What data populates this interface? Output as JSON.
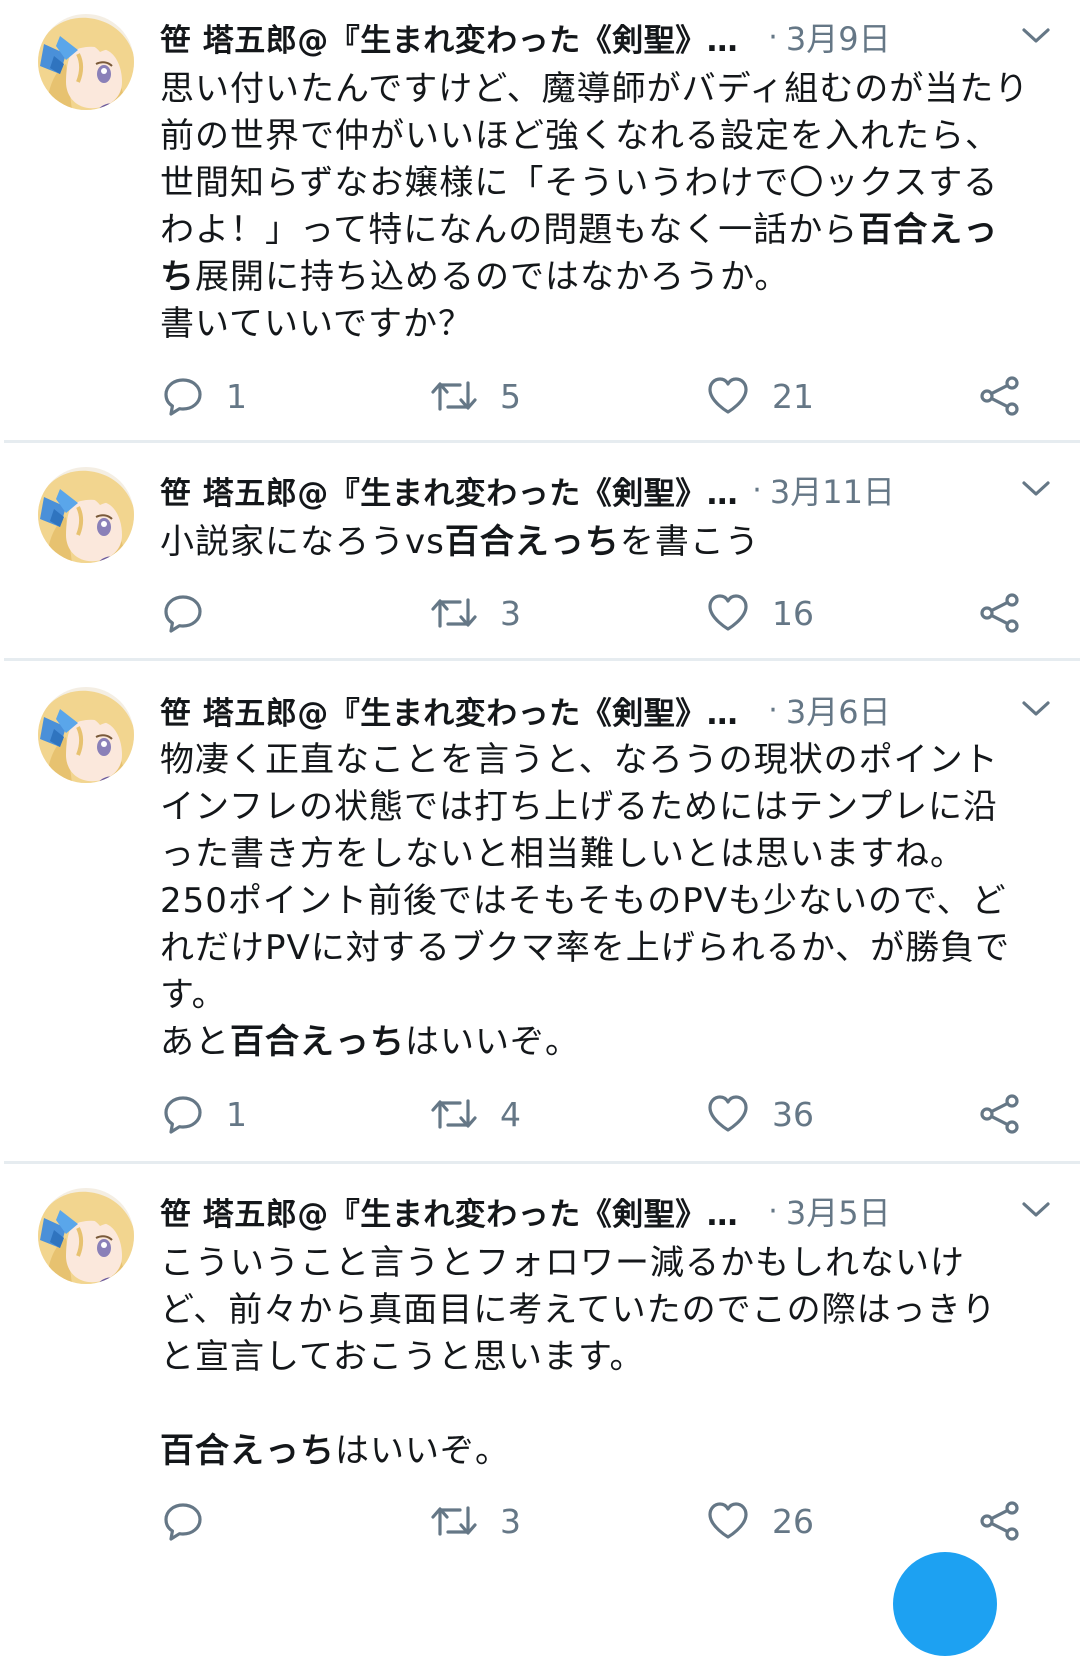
{
  "tweets": [
    {
      "author": "笹 塔五郎@『生まれ変わった《剣聖》…",
      "separator": "·",
      "date": "3月9日",
      "paragraphs": [
        [
          {
            "t": "思い付いたんですけど、魔導師がバディ組むのが当たり前の世界で仲がいいほど強くなれる設定を入れたら、世間知らずなお嬢様に「そういうわけで〇ックスするわよ！」って特になんの問題もなく一話から",
            "b": false
          },
          {
            "t": "百合えっち",
            "b": true
          },
          {
            "t": "展開に持ち込めるのではなかろうか。",
            "b": false
          }
        ],
        [
          {
            "t": "書いていいですか？",
            "b": false
          }
        ]
      ],
      "replies": "1",
      "retweets": "5",
      "likes": "21"
    },
    {
      "author": "笹 塔五郎@『生まれ変わった《剣聖》…",
      "separator": "·",
      "date": "3月11日",
      "paragraphs": [
        [
          {
            "t": "小説家になろうvs",
            "b": false
          },
          {
            "t": "百合えっち",
            "b": true
          },
          {
            "t": "を書こう",
            "b": false
          }
        ]
      ],
      "replies": "",
      "retweets": "3",
      "likes": "16"
    },
    {
      "author": "笹 塔五郎@『生まれ変わった《剣聖》…",
      "separator": "·",
      "date": "3月6日",
      "paragraphs": [
        [
          {
            "t": "物凄く正直なことを言うと、なろうの現状のポイントインフレの状態では打ち上げるためにはテンプレに沿った書き方をしないと相当難しいとは思いますね。",
            "b": false
          }
        ],
        [
          {
            "t": "250ポイント前後ではそもそものPVも少ないので、どれだけPVに対するブクマ率を上げられるか、が勝負です。",
            "b": false
          }
        ],
        [
          {
            "t": "あと",
            "b": false
          },
          {
            "t": "百合えっち",
            "b": true
          },
          {
            "t": "はいいぞ。",
            "b": false
          }
        ]
      ],
      "replies": "1",
      "retweets": "4",
      "likes": "36"
    },
    {
      "author": "笹 塔五郎@『生まれ変わった《剣聖》…",
      "separator": "·",
      "date": "3月5日",
      "paragraphs": [
        [
          {
            "t": "こういうこと言うとフォロワー減るかもしれないけど、前々から真面目に考えていたのでこの際はっきりと宣言しておこうと思います。",
            "b": false
          }
        ],
        [],
        [
          {
            "t": "百合えっち",
            "b": true
          },
          {
            "t": "はいいぞ。",
            "b": false
          }
        ]
      ],
      "replies": "",
      "retweets": "3",
      "likes": "26"
    }
  ],
  "icons": {
    "avatar": "anime-avatar-image",
    "caret": "chevron-down-icon",
    "reply": "reply-icon",
    "retweet": "retweet-icon",
    "like": "heart-icon",
    "share": "share-icon",
    "compose": "compose-fab"
  },
  "colors": {
    "text": "#14171a",
    "muted": "#657786",
    "divider": "#e6ecf0",
    "accent": "#1da1f2"
  }
}
